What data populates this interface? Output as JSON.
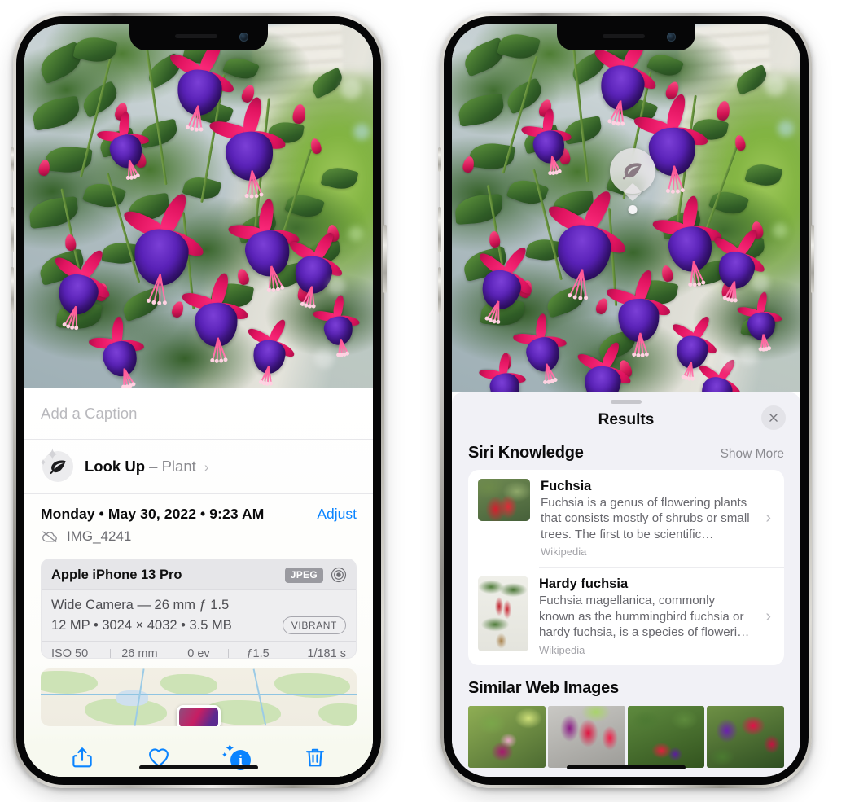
{
  "meta": {
    "accent_blue": "#0a84ff",
    "sheet_bg": "#f1f1f6",
    "card_bg": "#ffffff"
  },
  "left_phone": {
    "name": "photo-detail-screen",
    "caption": {
      "placeholder": "Add a Caption"
    },
    "lookup": {
      "title": "Look Up",
      "dash": "–",
      "subject": "Plant",
      "chevron": "›",
      "icon": "leaf-icon"
    },
    "info": {
      "date": "Monday • May 30, 2022 • 9:23 AM",
      "adjust_label": "Adjust",
      "filename": "IMG_4241",
      "cloud_icon": "cloud-slash-icon"
    },
    "camera_card": {
      "device": "Apple iPhone 13 Pro",
      "format_badge": "JPEG",
      "raw_icon": "aperture-icon",
      "lens": "Wide Camera — 26 mm ƒ 1.5",
      "dimensions": "12 MP • 3024 × 4032 • 3.5 MB",
      "profile_badge": "VIBRANT",
      "exif": [
        "ISO 50",
        "26 mm",
        "0 ev",
        "ƒ1.5",
        "1/181 s"
      ]
    },
    "toolbar": {
      "share_label": "Share",
      "favorite_label": "Favorite",
      "info_label": "Info",
      "delete_label": "Delete"
    }
  },
  "right_phone": {
    "name": "visual-lookup-results-screen",
    "bubble": {
      "icon": "leaf-icon"
    },
    "sheet": {
      "title": "Results",
      "close_label": "×"
    },
    "siri_knowledge": {
      "title": "Siri Knowledge",
      "action": "Show More",
      "items": [
        {
          "title": "Fuchsia",
          "description": "Fuchsia is a genus of flowering plants that consists mostly of shrubs or small trees. The first to be scientific…",
          "source": "Wikipedia",
          "chevron": "›"
        },
        {
          "title": "Hardy fuchsia",
          "description": "Fuchsia magellanica, commonly known as the hummingbird fuchsia or hardy fuchsia, is a species of floweri…",
          "source": "Wikipedia",
          "chevron": "›"
        }
      ]
    },
    "similar_web_images": {
      "title": "Similar Web Images",
      "count": 4
    }
  }
}
